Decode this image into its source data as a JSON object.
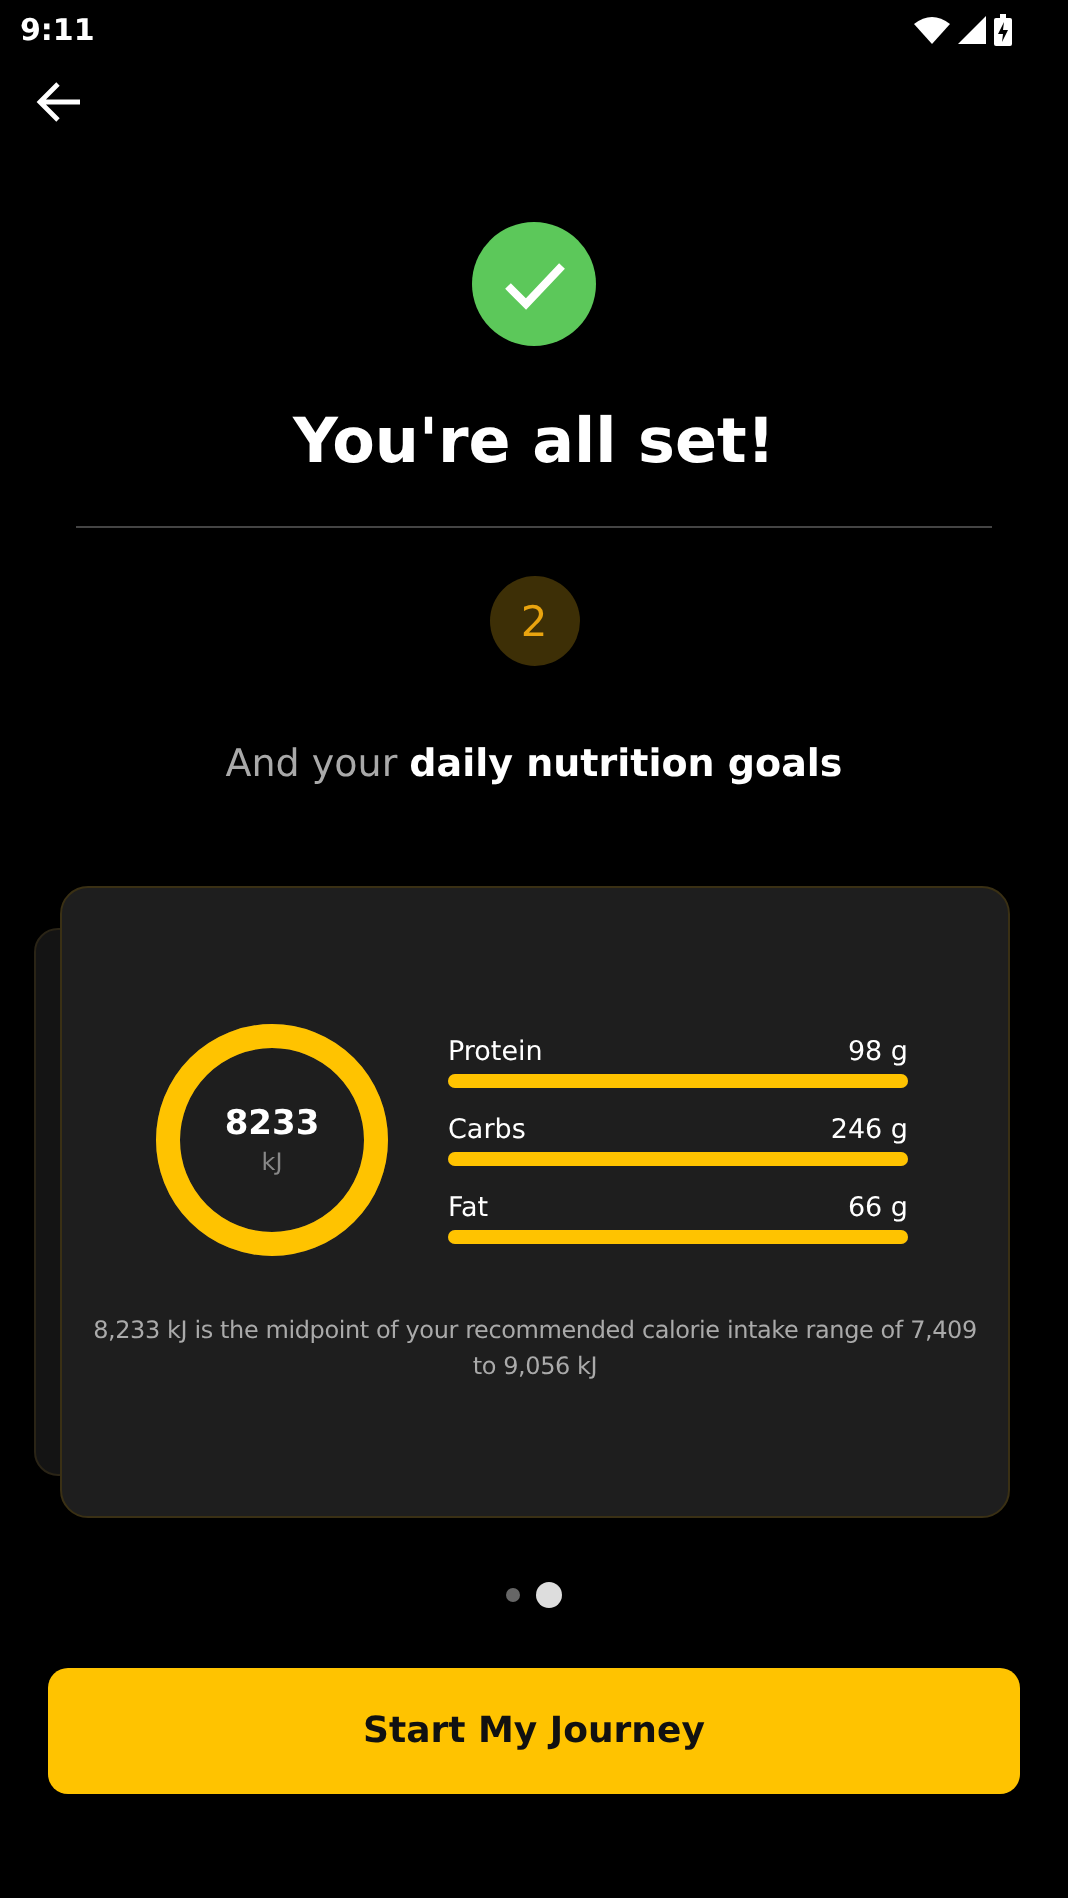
{
  "status_bar": {
    "time": "9:11"
  },
  "title": "You're all set!",
  "step": "2",
  "subtitle": "And your **daily nutrition goals**",
  "summary": {
    "energy": "8233",
    "unit": "kJ",
    "level": 1,
    "macros": [
      {
        "name": "Protein",
        "amount": "98 g",
        "level": 1
      },
      {
        "name": "Carbs",
        "amount": "246 g",
        "level": 1
      },
      {
        "name": "Fat",
        "amount": "66 g",
        "level": 1
      }
    ],
    "note": "8,233 kJ is the midpoint of your recommended calorie intake range of 7,409 to 9,056 kJ"
  },
  "pager": [
    {
      "selected": false
    },
    {
      "selected": true
    }
  ],
  "button": "Start My Journey"
}
